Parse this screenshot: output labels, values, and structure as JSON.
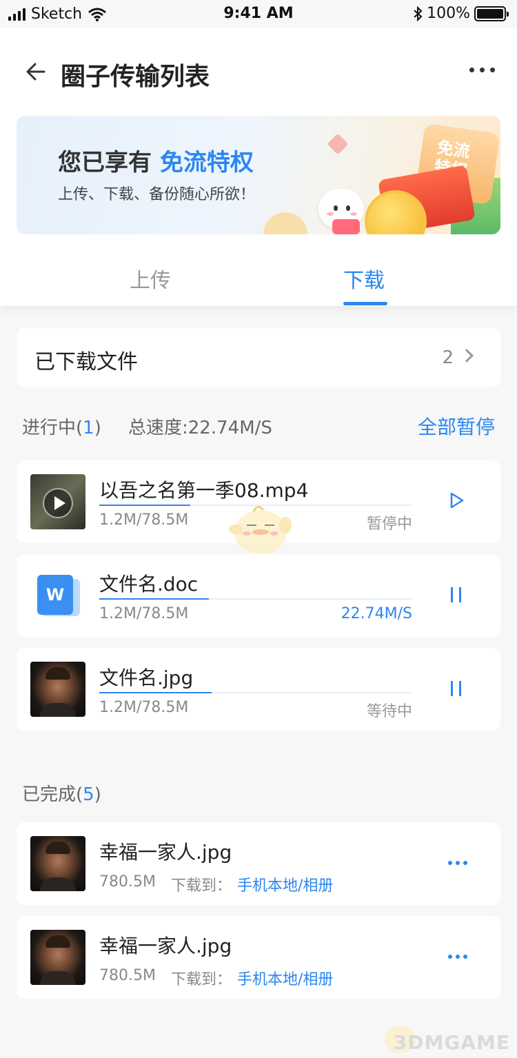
{
  "status_bar": {
    "carrier": "Sketch",
    "time": "9:41 AM",
    "battery": "100%"
  },
  "header": {
    "title": "圈子传输列表",
    "back_icon": "arrow-left-icon",
    "more_icon": "more-horizontal-icon"
  },
  "banner": {
    "headline_prefix": "您已享有 ",
    "headline_highlight": "免流特权",
    "subtitle": "上传、下载、备份随心所欲！",
    "ticket_text_1": "免流",
    "ticket_text_2": "特权"
  },
  "tabs": [
    {
      "label": "上传",
      "active": false
    },
    {
      "label": "下载",
      "active": true
    }
  ],
  "downloaded": {
    "label": "已下载文件",
    "count": "2"
  },
  "in_progress": {
    "label": "进行中(",
    "count": "1",
    "label_suffix": ")",
    "total_speed": "总速度:22.74M/S",
    "pause_all": "全部暂停",
    "items": [
      {
        "name": "以吾之名第一季08.mp4",
        "size": "1.2M/78.5M",
        "status": "暂停中",
        "progress": 0.29,
        "action": "play"
      },
      {
        "name": "文件名.doc",
        "size": "1.2M/78.5M",
        "status": "22.74M/S",
        "progress": 0.35,
        "action": "pause"
      },
      {
        "name": "文件名.jpg",
        "size": "1.2M/78.5M",
        "status": "等待中",
        "progress": 0.36,
        "action": "pause"
      }
    ]
  },
  "completed": {
    "label": "已完成(",
    "count": "5",
    "label_suffix": ")",
    "items": [
      {
        "name": "幸福一家人.jpg",
        "size": "780.5M",
        "dest_label": "下载到：",
        "dest": "手机本地/相册"
      },
      {
        "name": "幸福一家人.jpg",
        "size": "780.5M",
        "dest_label": "下载到：",
        "dest": "手机本地/相册"
      }
    ]
  },
  "watermark": "3DMGAME",
  "colors": {
    "accent": "#2b86f0",
    "background": "#f7f7f8"
  }
}
